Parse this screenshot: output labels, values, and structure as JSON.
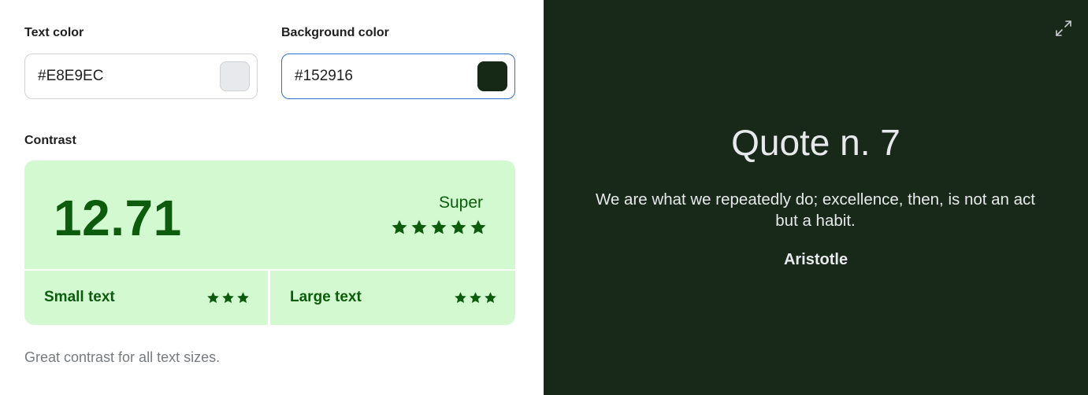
{
  "text_color": {
    "label": "Text color",
    "value": "#E8E9EC",
    "swatch": "#E8E9EC"
  },
  "background_color": {
    "label": "Background color",
    "value": "#152916",
    "swatch": "#152916"
  },
  "contrast": {
    "label": "Contrast",
    "ratio": "12.71",
    "rating": "Super",
    "rating_stars": 5,
    "small_text": {
      "label": "Small text",
      "stars": 3
    },
    "large_text": {
      "label": "Large text",
      "stars": 3
    },
    "summary": "Great contrast for all text sizes.",
    "card_color": "#D3F9D1",
    "accent_color": "#0D5C0D"
  },
  "preview": {
    "title": "Quote n. 7",
    "quote": "We are what we repeatedly do; excellence, then, is not an act but a habit.",
    "author": "Aristotle",
    "expand_icon": "expand-icon"
  }
}
